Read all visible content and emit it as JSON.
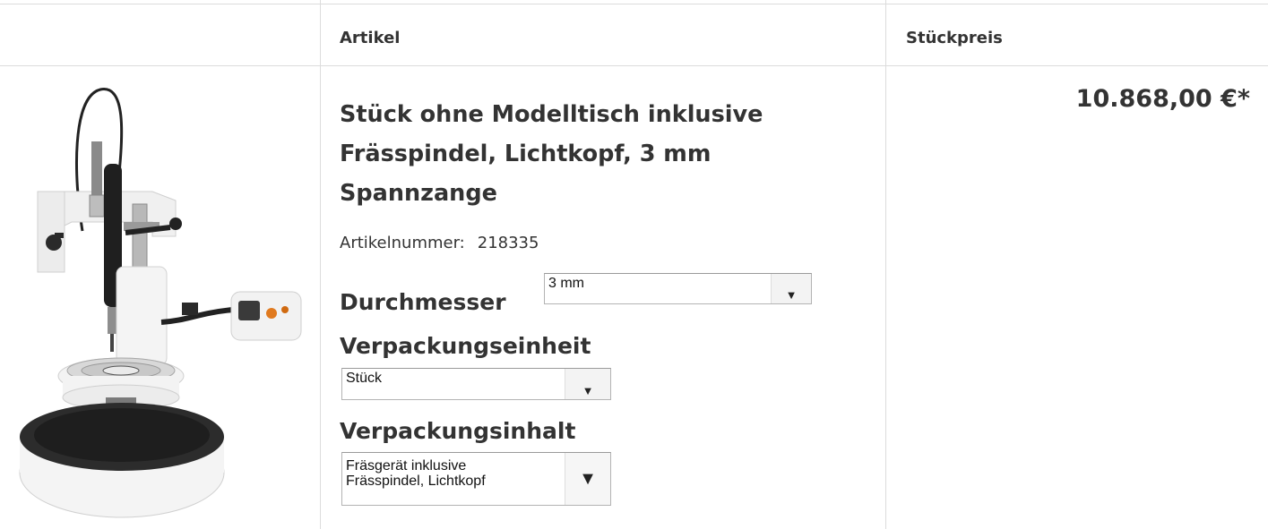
{
  "table": {
    "header_article": "Artikel",
    "header_unit_price": "Stückpreis"
  },
  "product": {
    "title": "Stück ohne Modelltisch inklusive Frässpindel, Lichtkopf, 3 mm Spannzange",
    "article_number_label": "Artikelnummer:",
    "article_number": "218335",
    "price": "10.868,00 €*"
  },
  "options": {
    "diameter_label": "Durchmesser",
    "diameter_value": "3 mm",
    "packaging_unit_label": "Verpackungseinheit",
    "packaging_unit_value": "Stück",
    "packaging_content_label": "Verpackungsinhalt",
    "packaging_content_value_line1": "Fräsgerät inklusive",
    "packaging_content_value_line2": "Frässpindel, Lichtkopf"
  },
  "icons": {
    "dropdown": "triangle-down-icon"
  }
}
